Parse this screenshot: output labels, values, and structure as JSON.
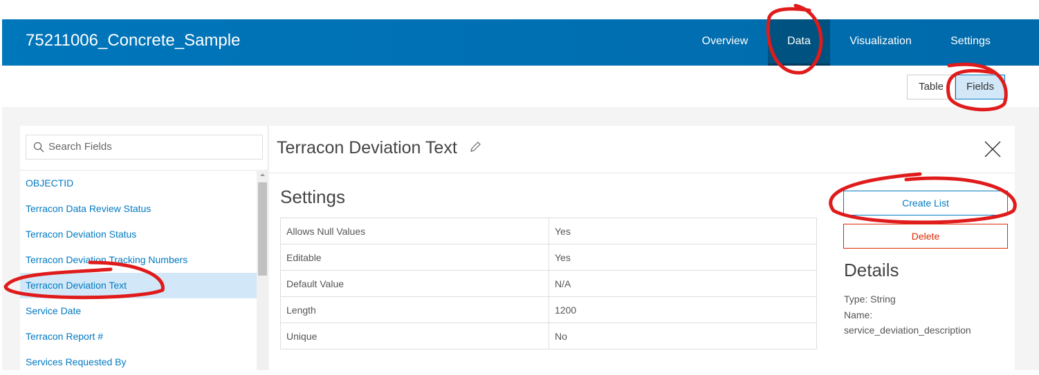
{
  "header": {
    "title": "75211006_Concrete_Sample",
    "nav": [
      "Overview",
      "Data",
      "Visualization",
      "Settings"
    ],
    "active": "Data"
  },
  "view_toggle": {
    "table": "Table",
    "fields": "Fields",
    "active": "Fields"
  },
  "sidebar": {
    "search_placeholder": "Search Fields",
    "items": [
      "OBJECTID",
      "Terracon Data Review Status",
      "Terracon Deviation Status",
      "Terracon Deviation Tracking Numbers",
      "Terracon Deviation Text",
      "Service Date",
      "Terracon Report #",
      "Services Requested By"
    ],
    "selected": "Terracon Deviation Text"
  },
  "field": {
    "title": "Terracon Deviation Text",
    "settings_heading": "Settings",
    "settings": [
      {
        "label": "Allows Null Values",
        "value": "Yes"
      },
      {
        "label": "Editable",
        "value": "Yes"
      },
      {
        "label": "Default Value",
        "value": "N/A"
      },
      {
        "label": "Length",
        "value": "1200"
      },
      {
        "label": "Unique",
        "value": "No"
      }
    ],
    "create_list": "Create List",
    "delete": "Delete",
    "details_heading": "Details",
    "type": "Type: String",
    "name_label": "Name:",
    "name_value": "service_deviation_description"
  },
  "colors": {
    "accent": "#0079c1",
    "header": "#0074b9",
    "danger": "#de2900",
    "annotation": "#e01b1b"
  }
}
